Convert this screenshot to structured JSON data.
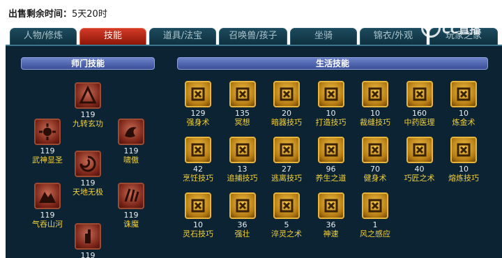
{
  "sale": {
    "label": "出售剩余时间：",
    "value": "5天20时"
  },
  "tabs": [
    {
      "label": "人物/修炼"
    },
    {
      "label": "技能"
    },
    {
      "label": "道具/法宝"
    },
    {
      "label": "召唤兽/孩子"
    },
    {
      "label": "坐骑"
    },
    {
      "label": "锦衣/外观"
    },
    {
      "label": "玩家之家"
    }
  ],
  "watermark": "CC直播",
  "school": {
    "title": "师门技能",
    "skills": [
      {
        "name": "九转玄功",
        "level": "119",
        "icon": "spiral-icon"
      },
      {
        "name": "武神显圣",
        "level": "119",
        "icon": "sun-icon"
      },
      {
        "name": "啸傲",
        "level": "119",
        "icon": "dragon-icon"
      },
      {
        "name": "天地无极",
        "level": "119",
        "icon": "swirl-icon"
      },
      {
        "name": "气吞山河",
        "level": "119",
        "icon": "mountain-icon"
      },
      {
        "name": "诛魔",
        "level": "119",
        "icon": "claw-icon"
      },
      {
        "name": "",
        "level": "119",
        "icon": "hand-icon"
      }
    ]
  },
  "life": {
    "title": "生活技能",
    "skills": [
      {
        "name": "强身术",
        "level": "129",
        "icon": "muscle-icon"
      },
      {
        "name": "冥想",
        "level": "135",
        "icon": "meditate-icon"
      },
      {
        "name": "暗器技巧",
        "level": "20",
        "icon": "dart-icon"
      },
      {
        "name": "打造技巧",
        "level": "10",
        "icon": "hammer-icon"
      },
      {
        "name": "裁缝技巧",
        "level": "10",
        "icon": "scissors-icon"
      },
      {
        "name": "中药医理",
        "level": "160",
        "icon": "herb-icon"
      },
      {
        "name": "炼金术",
        "level": "10",
        "icon": "alchemy-icon"
      },
      {
        "name": "烹饪技巧",
        "level": "42",
        "icon": "pot-icon"
      },
      {
        "name": "追捕技巧",
        "level": "13",
        "icon": "chain-icon"
      },
      {
        "name": "逃离技巧",
        "level": "27",
        "icon": "escape-icon"
      },
      {
        "name": "养生之道",
        "level": "96",
        "icon": "temple-icon"
      },
      {
        "name": "健身术",
        "level": "70",
        "icon": "fitness-icon"
      },
      {
        "name": "巧匠之术",
        "level": "40",
        "icon": "workshop-icon"
      },
      {
        "name": "熔炼技巧",
        "level": "10",
        "icon": "furnace-icon"
      },
      {
        "name": "灵石技巧",
        "level": "10",
        "icon": "gem-icon"
      },
      {
        "name": "强壮",
        "level": "36",
        "icon": "strong-icon"
      },
      {
        "name": "淬灵之术",
        "level": "5",
        "icon": "tornado-icon"
      },
      {
        "name": "神速",
        "level": "36",
        "icon": "speed-icon"
      },
      {
        "name": "风之感应",
        "level": "1",
        "icon": "wind-icon"
      }
    ]
  },
  "colors": {
    "accent": "#d23a26",
    "panel": "#0c2333",
    "label": "#f4d23a",
    "header": "#4a5fa8"
  }
}
